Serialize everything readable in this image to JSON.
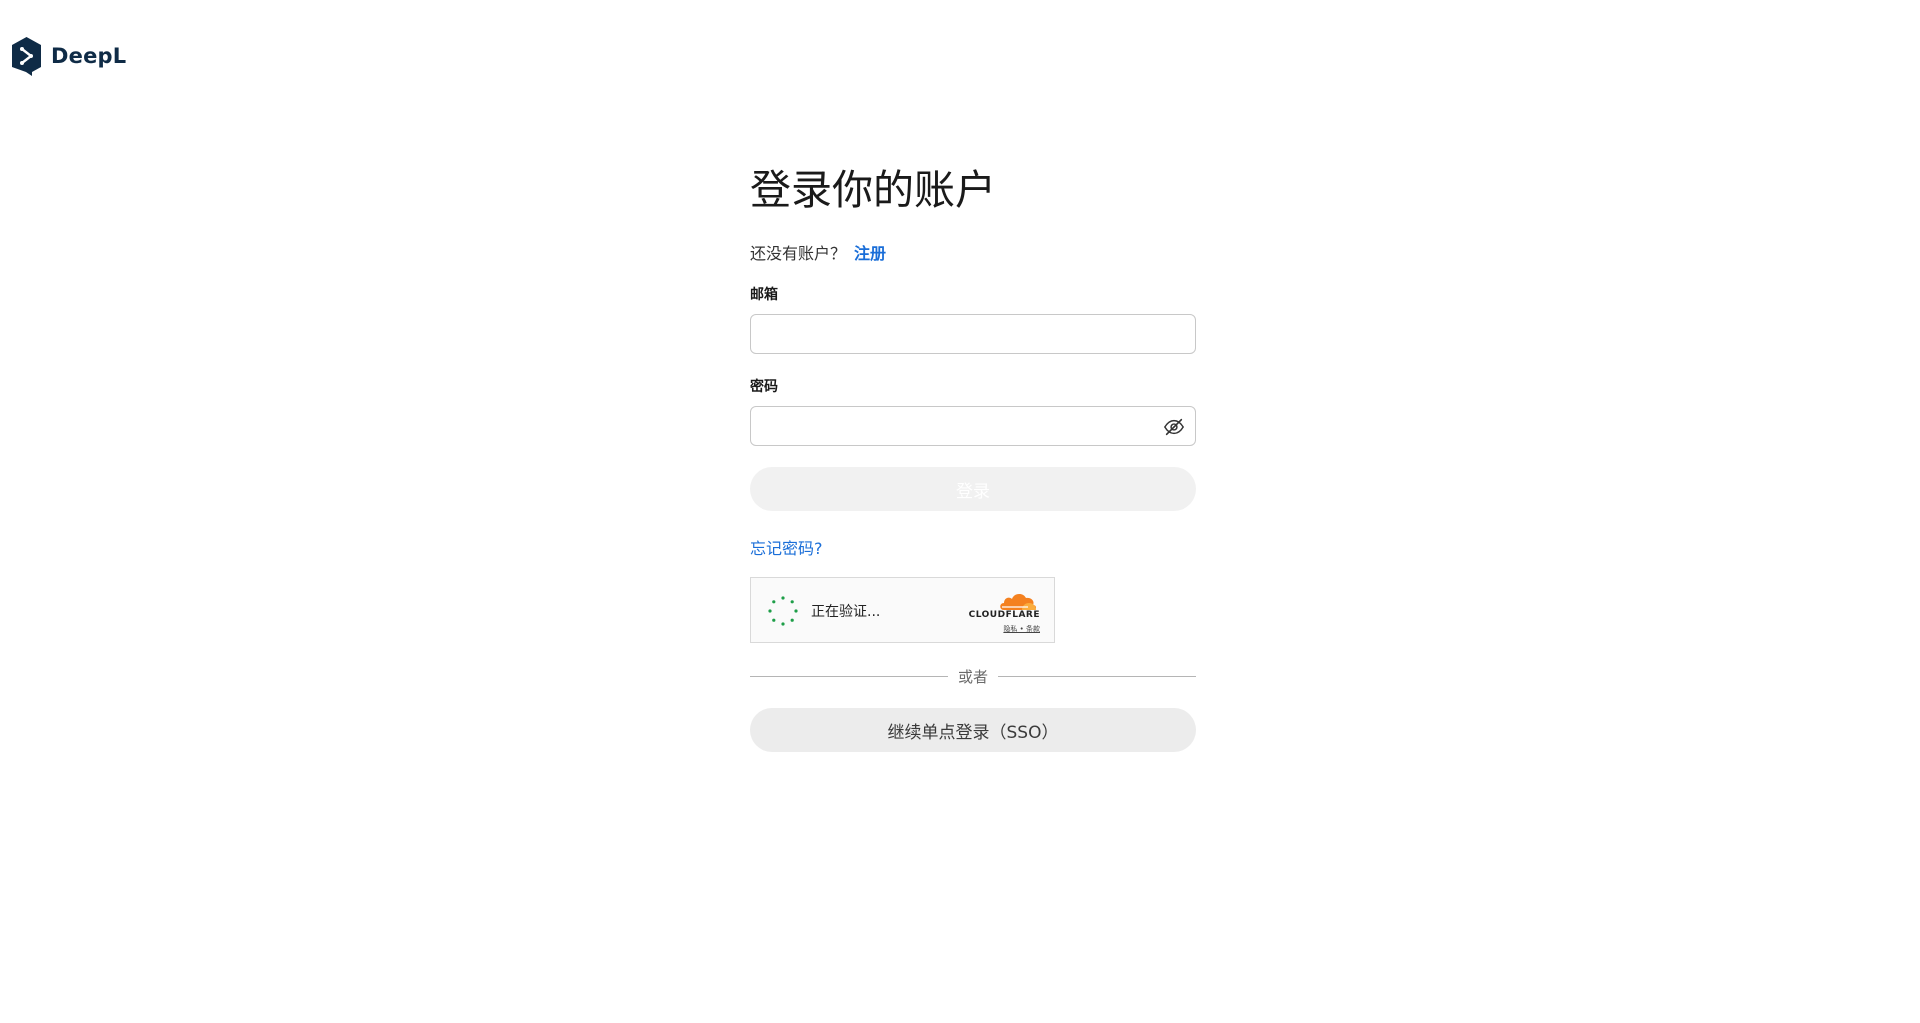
{
  "brand": {
    "name": "DeepL",
    "color": "#0f2b46"
  },
  "login": {
    "title": "登录你的账户",
    "no_account_text": "还没有账户？",
    "signup_link": "注册",
    "email_label": "邮箱",
    "email_value": "",
    "password_label": "密码",
    "password_value": "",
    "password_toggle_icon": "eye-off-icon",
    "submit_label": "登录",
    "forgot_link": "忘记密码?",
    "or_text": "或者",
    "sso_label": "继续单点登录（SSO）"
  },
  "captcha": {
    "status_text": "正在验证...",
    "provider": "CLOUDFLARE",
    "links_text": "隐私 • 条款"
  },
  "colors": {
    "link": "#1a6ed8",
    "disabled_button": "#f1f1f1",
    "sso_button": "#ececec",
    "cloudflare_orange": "#f48120",
    "spinner_green": "#1e9e48"
  }
}
